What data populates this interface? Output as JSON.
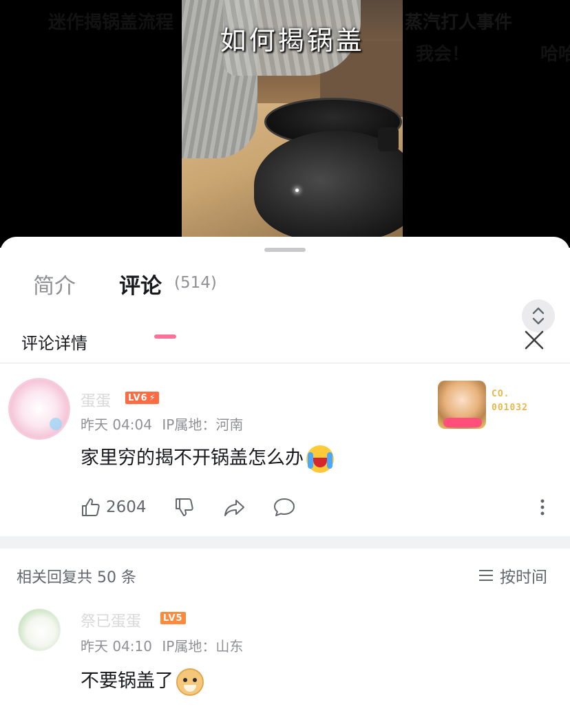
{
  "video": {
    "title": "如何揭锅盖",
    "danmaku": [
      "迷作揭锅盖流程",
      "蒸汽打人事件",
      "我会！",
      "哈哈"
    ]
  },
  "tabs": [
    {
      "label": "简介"
    },
    {
      "label": "评论",
      "count": "(514)"
    }
  ],
  "detail": {
    "title": "评论详情"
  },
  "main_comment": {
    "username": "蛋蛋",
    "level": "LV6",
    "time": "昨天 04:04",
    "ip": "IP属地：河南",
    "text": "家里穷的揭不开锅盖怎么办",
    "emoji": "cry-emoji",
    "likes": "2604",
    "fan_badge": {
      "line1": "CO.",
      "line2": "001032"
    },
    "level_color": "#ff6b42"
  },
  "replies": {
    "count_label": "相关回复共 50 条",
    "sort_label": "按时间"
  },
  "reply": {
    "username": "祭已蛋蛋",
    "level": "LV5",
    "level_color": "#ff8a3d",
    "time": "昨天 04:10",
    "ip": "IP属地：山东",
    "text": "不要锅盖了",
    "emoji": "doge-emoji"
  },
  "colors": {
    "accent": "#fb7299",
    "text_primary": "#18191c",
    "text_secondary": "#61666d"
  }
}
